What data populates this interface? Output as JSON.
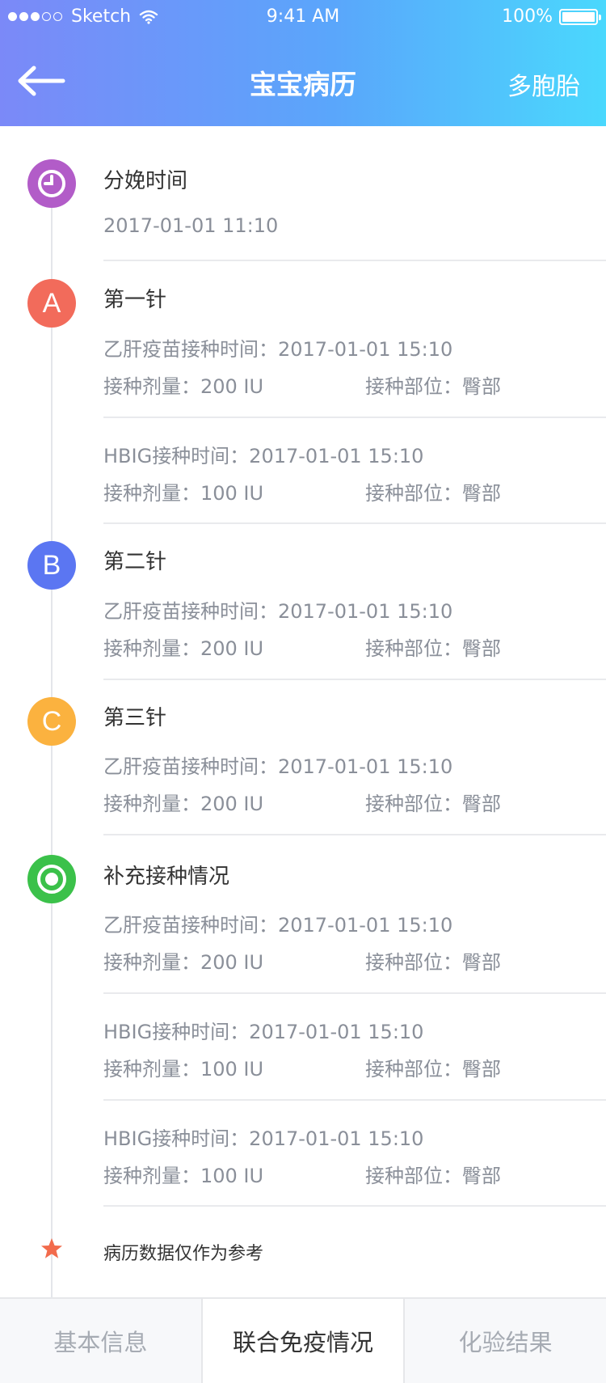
{
  "status_bar": {
    "carrier": "Sketch",
    "time": "9:41 AM",
    "battery": "100%"
  },
  "nav": {
    "title": "宝宝病历",
    "action": "多胞胎",
    "back_icon": "arrow-left-icon"
  },
  "delivery": {
    "icon": "clock-icon",
    "title": "分娩时间",
    "time": "2017-01-01 11:10"
  },
  "doses": [
    {
      "marker": "A",
      "color": "#f26b5b",
      "title": "第一针",
      "records": [
        {
          "time_text": "乙肝疫苗接种时间：2017-01-01 15:10",
          "dose_text": "接种剂量：200 IU",
          "site_text": "接种部位：臀部"
        },
        {
          "time_text": "HBIG接种时间：2017-01-01 15:10",
          "dose_text": "接种剂量：100 IU",
          "site_text": "接种部位：臀部"
        }
      ]
    },
    {
      "marker": "B",
      "color": "#5b76f2",
      "title": "第二针",
      "records": [
        {
          "time_text": "乙肝疫苗接种时间：2017-01-01 15:10",
          "dose_text": "接种剂量：200 IU",
          "site_text": "接种部位：臀部"
        }
      ]
    },
    {
      "marker": "C",
      "color": "#fbb23f",
      "title": "第三针",
      "records": [
        {
          "time_text": "乙肝疫苗接种时间：2017-01-01 15:10",
          "dose_text": "接种剂量：200 IU",
          "site_text": "接种部位：臀部"
        }
      ]
    }
  ],
  "supplement": {
    "icon": "target-icon",
    "color": "#3bc14a",
    "title": "补充接种情况",
    "records": [
      {
        "time_text": "乙肝疫苗接种时间：2017-01-01 15:10",
        "dose_text": "接种剂量：200 IU",
        "site_text": "接种部位：臀部"
      },
      {
        "time_text": "HBIG接种时间：2017-01-01 15:10",
        "dose_text": "接种剂量：100 IU",
        "site_text": "接种部位：臀部"
      },
      {
        "time_text": "HBIG接种时间：2017-01-01 15:10",
        "dose_text": "接种剂量：100 IU",
        "site_text": "接种部位：臀部"
      }
    ]
  },
  "note": {
    "icon": "star-icon",
    "text": "病历数据仅作为参考"
  },
  "tabs": [
    {
      "label": "基本信息",
      "active": false
    },
    {
      "label": "联合免疫情况",
      "active": true
    },
    {
      "label": "化验结果",
      "active": false
    }
  ],
  "colors": {
    "header_start": "#7b89f8",
    "header_end": "#4ad8fd",
    "delivery": "#b25cc8",
    "star": "#f26b4c"
  }
}
